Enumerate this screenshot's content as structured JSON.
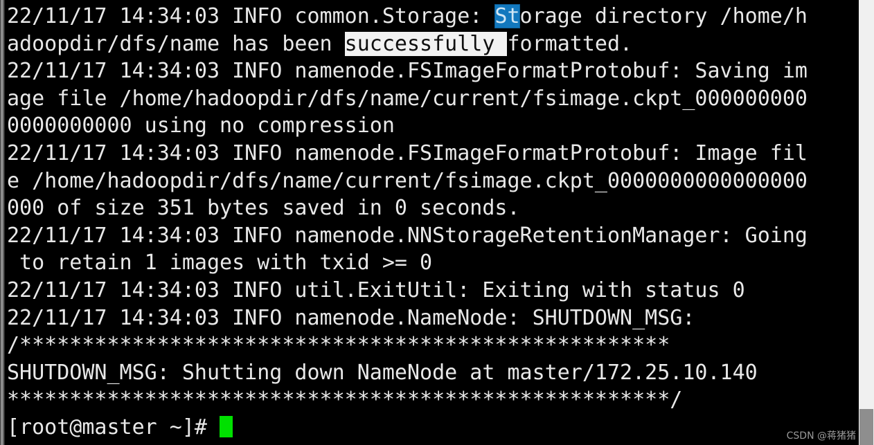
{
  "terminal": {
    "prompt": "[root@master ~]# ",
    "cursor": "block-cursor",
    "colors": {
      "background": "#000000",
      "foreground": "#e8e8e8",
      "cursor": "#00e000",
      "selection_blue": "#1278be",
      "highlight_white": "#f2f2f2",
      "scrollbar_track": "#f0f0f0",
      "scrollbar_thumb": "#8e8e8e"
    },
    "lines": [
      {
        "id": "l1",
        "text": "22/11/17 14:34:03 INFO common.Storage: "
      },
      {
        "id": "l1b",
        "text": "St"
      },
      {
        "id": "l1c",
        "text": "orage directory /home/h"
      },
      {
        "id": "l2",
        "text": "adoopdir/dfs/name has been "
      },
      {
        "id": "l2b",
        "text": "successfully "
      },
      {
        "id": "l2c",
        "text": "formatted."
      },
      {
        "id": "l3",
        "text": "22/11/17 14:34:03 INFO namenode.FSImageFormatProtobuf: Saving im"
      },
      {
        "id": "l4",
        "text": "age file /home/hadoopdir/dfs/name/current/fsimage.ckpt_000000000"
      },
      {
        "id": "l5",
        "text": "0000000000 using no compression"
      },
      {
        "id": "l6",
        "text": "22/11/17 14:34:03 INFO namenode.FSImageFormatProtobuf: Image fil"
      },
      {
        "id": "l7",
        "text": "e /home/hadoopdir/dfs/name/current/fsimage.ckpt_0000000000000000"
      },
      {
        "id": "l8",
        "text": "000 of size 351 bytes saved in 0 seconds."
      },
      {
        "id": "l9",
        "text": "22/11/17 14:34:03 INFO namenode.NNStorageRetentionManager: Going"
      },
      {
        "id": "l10",
        "text": " to retain 1 images with txid >= 0"
      },
      {
        "id": "l11",
        "text": "22/11/17 14:34:03 INFO util.ExitUtil: Exiting with status 0"
      },
      {
        "id": "l12",
        "text": "22/11/17 14:34:03 INFO namenode.NameNode: SHUTDOWN_MSG:"
      },
      {
        "id": "l13",
        "text": "/****************************************************"
      },
      {
        "id": "l14",
        "text": "SHUTDOWN_MSG: Shutting down NameNode at master/172.25.10.140"
      },
      {
        "id": "l15",
        "text": "*****************************************************/"
      }
    ]
  },
  "watermark": {
    "text": "CSDN @蒋猪猪"
  }
}
